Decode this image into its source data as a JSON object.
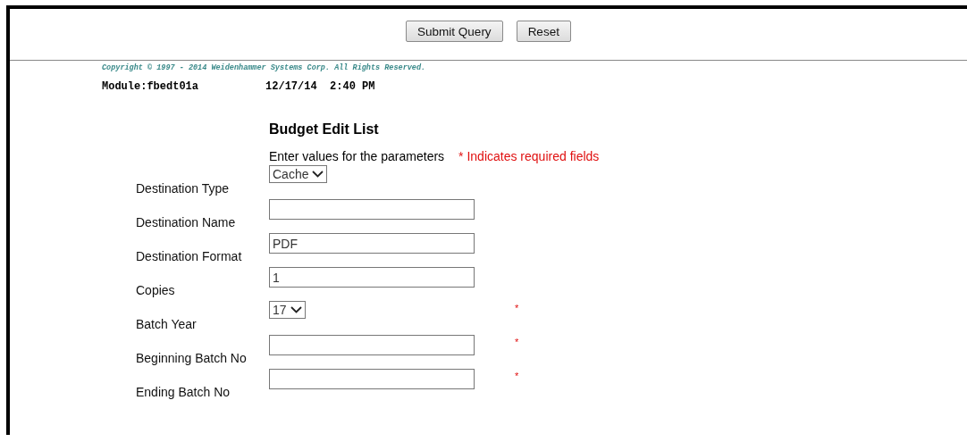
{
  "buttons": [
    "Submit Query",
    "Reset"
  ],
  "copyright": "Copyright © 1997 - 2014 Weidenhammer Systems Corp. All Rights Reserved.",
  "module": "Module:fbedt01a",
  "timestamp": "12/17/14  2:40 PM",
  "form": {
    "title": "Budget Edit List",
    "instructions": "Enter values for the parameters",
    "required_note": "* Indicates required fields",
    "required_mark": "*",
    "fields": [
      {
        "label": "Destination Type",
        "kind": "select",
        "value": "Cache",
        "required": false
      },
      {
        "label": "Destination Name",
        "kind": "text",
        "required": false
      },
      {
        "label": "Destination Format",
        "kind": "text",
        "value": "PDF",
        "required": false
      },
      {
        "label": "Copies",
        "kind": "text",
        "value": "1",
        "required": false
      },
      {
        "label": "Batch Year",
        "kind": "select",
        "value": "17",
        "required": true
      },
      {
        "label": "Beginning Batch No",
        "kind": "text",
        "required": true
      },
      {
        "label": "Ending Batch No",
        "kind": "text",
        "required": true
      }
    ]
  }
}
